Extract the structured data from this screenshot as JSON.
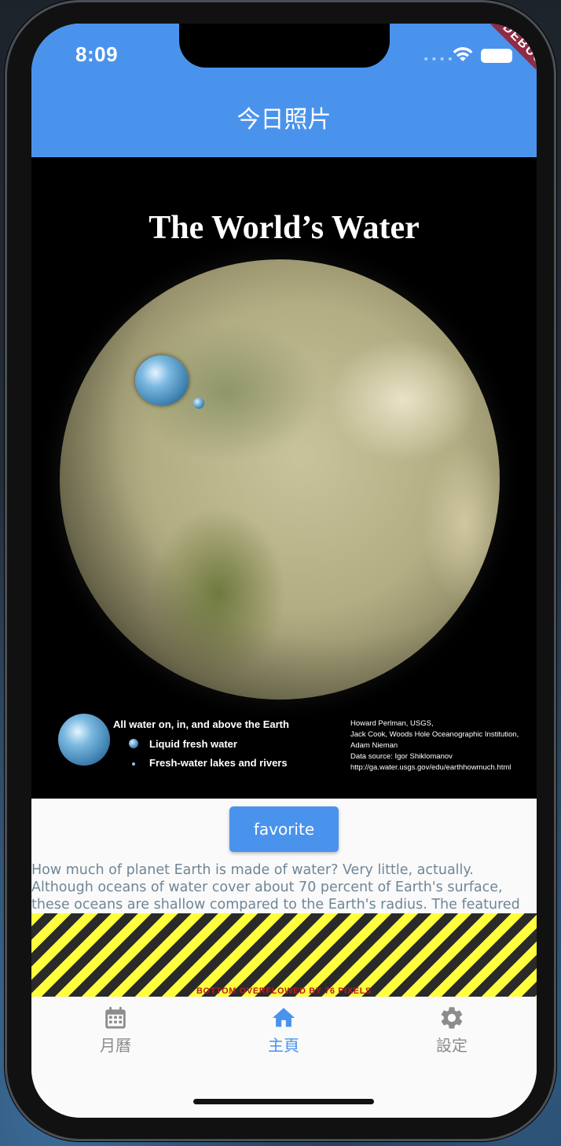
{
  "status_bar": {
    "time": "8:09",
    "debug_banner": "DEBUG"
  },
  "app_bar": {
    "title": "今日照片",
    "color": "#4a93ec"
  },
  "photo": {
    "heading": "The World’s Water",
    "legend": [
      "All water on, in, and above the Earth",
      "Liquid fresh water",
      "Fresh-water lakes and rivers"
    ],
    "credits": [
      "Howard Perlman, USGS,",
      "Jack Cook, Woods Hole Oceanographic Institution,",
      "Adam Nieman",
      "Data source: Igor Shiklomanov",
      "http://ga.water.usgs.gov/edu/earthhowmuch.html"
    ]
  },
  "content": {
    "favorite_label": "favorite",
    "description": "How much of planet Earth is made of water? Very little, actually. Although oceans of water cover about 70 percent of Earth's surface, these oceans are shallow compared to the Earth's radius. The featured illustration shows what would happen if all of the water on or near the surface of the Earth were bunched up into a ball. The radius of this ball would be only about 700 kilometers, less than half the radius of the Earth's Moon, but slightly larger than Saturn's",
    "overflow_warning": "BOTTOM OVERFLOWED BY 76 PIXELS"
  },
  "bottom_nav": {
    "items": [
      {
        "label": "月曆",
        "icon": "calendar-icon",
        "active": false
      },
      {
        "label": "主頁",
        "icon": "home-icon",
        "active": true
      },
      {
        "label": "設定",
        "icon": "gear-icon",
        "active": false
      }
    ],
    "active_color": "#4a93ec",
    "inactive_color": "#8c8c8c"
  }
}
